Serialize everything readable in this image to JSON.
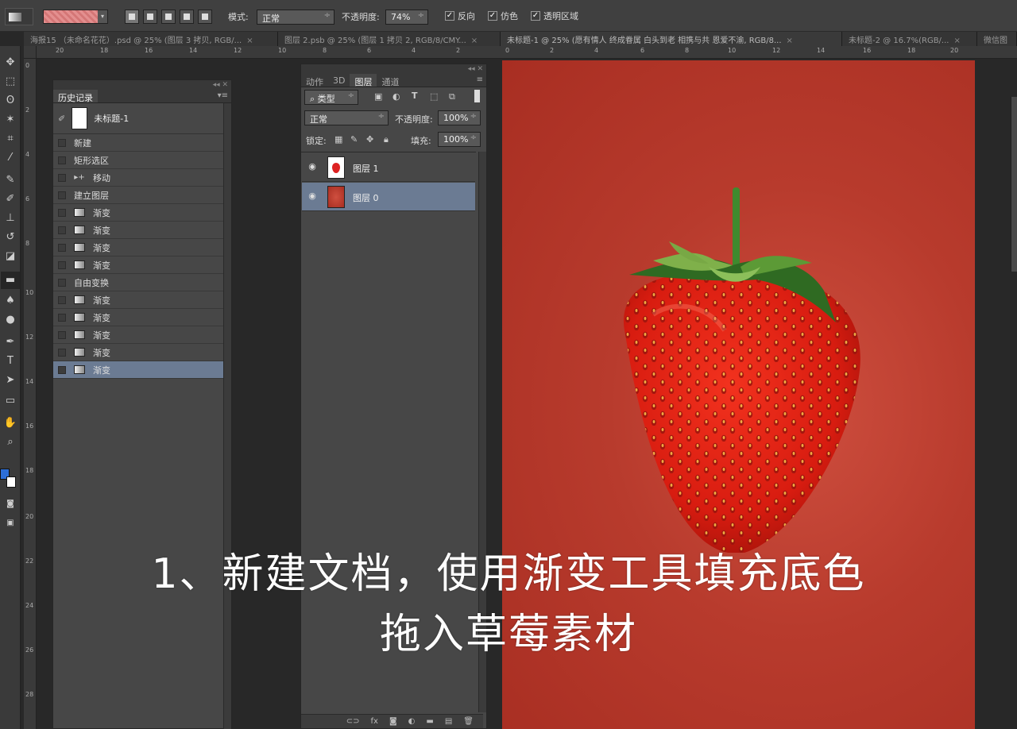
{
  "options_bar": {
    "mode_label": "模式:",
    "mode_value": "正常",
    "opacity_label": "不透明度:",
    "opacity_value": "74%",
    "reverse_label": "反向",
    "dither_label": "仿色",
    "transparency_label": "透明区域"
  },
  "tabs": [
    {
      "label": "海报15 （未命名花花）.psd @ 25% (图层 3 拷贝, RGB/..."
    },
    {
      "label": "图层 2.psb @ 25% (图层 1 拷贝 2, RGB/8/CMY..."
    },
    {
      "label": "未标题-1 @ 25% (愿有情人 终成眷属 白头到老 相携与共 恩爱不渝, RGB/8..."
    },
    {
      "label": "未标题-2 @ 16.7%(RGB/..."
    },
    {
      "label": "微信图"
    }
  ],
  "history_panel": {
    "title": "历史记录",
    "snapshot": "未标题-1",
    "items": [
      "新建",
      "矩形选区",
      "移动",
      "建立图层",
      "渐变",
      "渐变",
      "渐变",
      "渐变",
      "自由变换",
      "渐变",
      "渐变",
      "渐变",
      "渐变",
      "渐变"
    ],
    "selected_index": 13
  },
  "layers_panel": {
    "tabs": [
      "动作",
      "3D",
      "图层",
      "通道"
    ],
    "active_tab": "图层",
    "filter_kind": "类型",
    "blend_mode": "正常",
    "opacity_label": "不透明度:",
    "opacity_value": "100%",
    "lock_label": "锁定:",
    "fill_label": "填充:",
    "fill_value": "100%",
    "layers": [
      {
        "name": "图层 1",
        "thumb": "strawberry"
      },
      {
        "name": "图层 0",
        "thumb": "red-fill"
      }
    ],
    "selected_layer": "图层 0"
  },
  "caption": {
    "line1": "1、新建文档，使用渐变工具填充底色",
    "line2": "拖入草莓素材"
  },
  "colors": {
    "foreground": "#2d6fd8",
    "background": "#ffffff",
    "canvas": "#b83b2d",
    "selection": "#6b7b93"
  }
}
